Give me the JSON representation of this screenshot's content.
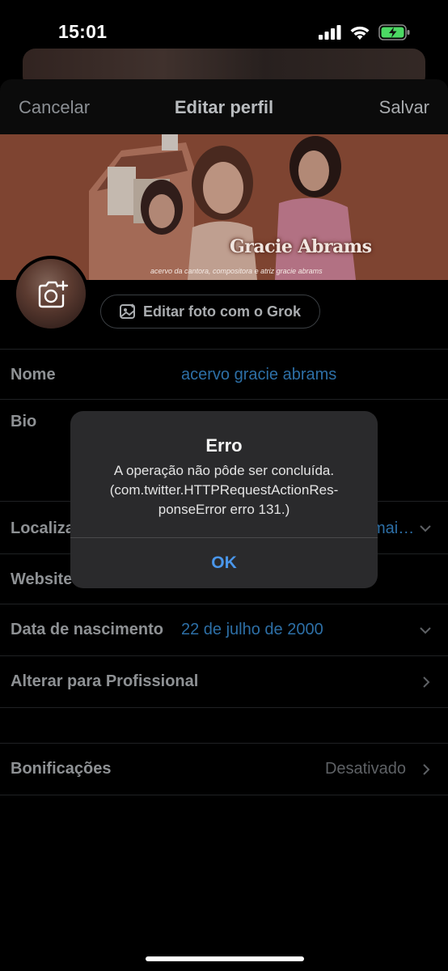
{
  "status_bar": {
    "time": "15:01"
  },
  "navbar": {
    "cancel": "Cancelar",
    "title": "Editar perfil",
    "save": "Salvar"
  },
  "banner": {
    "title": "Gracie Abrams",
    "tagline": "acervo da cantora, compositora e atriz gracie abrams"
  },
  "grok_button": {
    "label": "Editar foto com o Grok"
  },
  "fields": {
    "name": {
      "label": "Nome",
      "value": "acervo gracie abrams"
    },
    "bio": {
      "label": "Bio"
    },
    "location": {
      "label": "Localiza",
      "value": "mai…"
    },
    "website": {
      "label": "Website"
    },
    "birthdate": {
      "label": "Data de nascimento",
      "value": "22 de julho de 2000"
    },
    "professional": {
      "label": "Alterar para Profissional"
    },
    "tips": {
      "label": "Bonificações",
      "value": "Desativado"
    }
  },
  "dialog": {
    "title": "Erro",
    "message": "A operação não pôde ser concluída. (com.twitter.HTTPRequestActionRes-ponseError erro 131.)",
    "ok": "OK"
  },
  "colors": {
    "link_blue": "#2d6fa6",
    "dialog_button": "#4a96ea",
    "battery_green": "#4cd964"
  }
}
